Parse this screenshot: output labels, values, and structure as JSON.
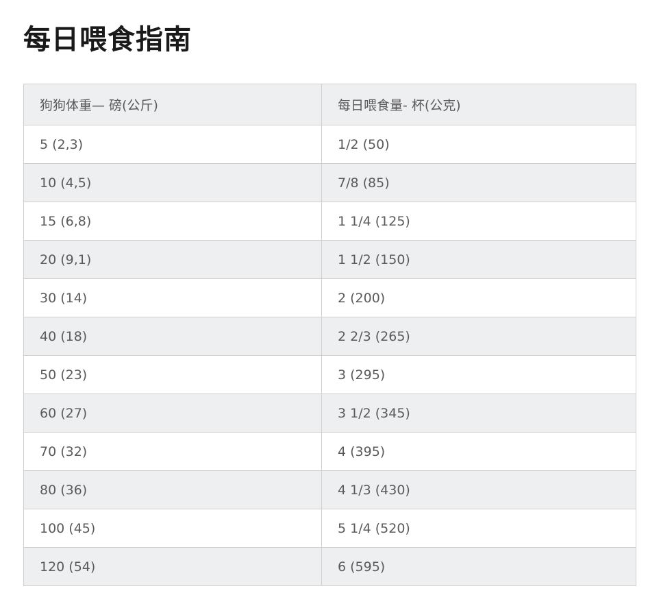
{
  "page": {
    "title": "每日喂食指南"
  },
  "table": {
    "headers": [
      "狗狗体重— 磅(公斤)",
      "每日喂食量- 杯(公克)"
    ],
    "rows": [
      [
        "5 (2,3)",
        "1/2 (50)"
      ],
      [
        "10 (4,5)",
        "7/8 (85)"
      ],
      [
        "15 (6,8)",
        "1 1/4 (125)"
      ],
      [
        "20 (9,1)",
        "1 1/2 (150)"
      ],
      [
        "30 (14)",
        "2 (200)"
      ],
      [
        "40 (18)",
        "2 2/3 (265)"
      ],
      [
        "50 (23)",
        "3 (295)"
      ],
      [
        "60 (27)",
        "3 1/2 (345)"
      ],
      [
        "70 (32)",
        "4 (395)"
      ],
      [
        "80 (36)",
        "4 1/3 (430)"
      ],
      [
        "100 (45)",
        "5 1/4 (520)"
      ],
      [
        "120 (54)",
        "6 (595)"
      ]
    ]
  },
  "colors": {
    "title": "#1a1a1a",
    "text": "#5a5a5a",
    "header_bg": "#eeeff1",
    "stripe_bg": "#eeeff1",
    "border": "#cfcfcf"
  }
}
